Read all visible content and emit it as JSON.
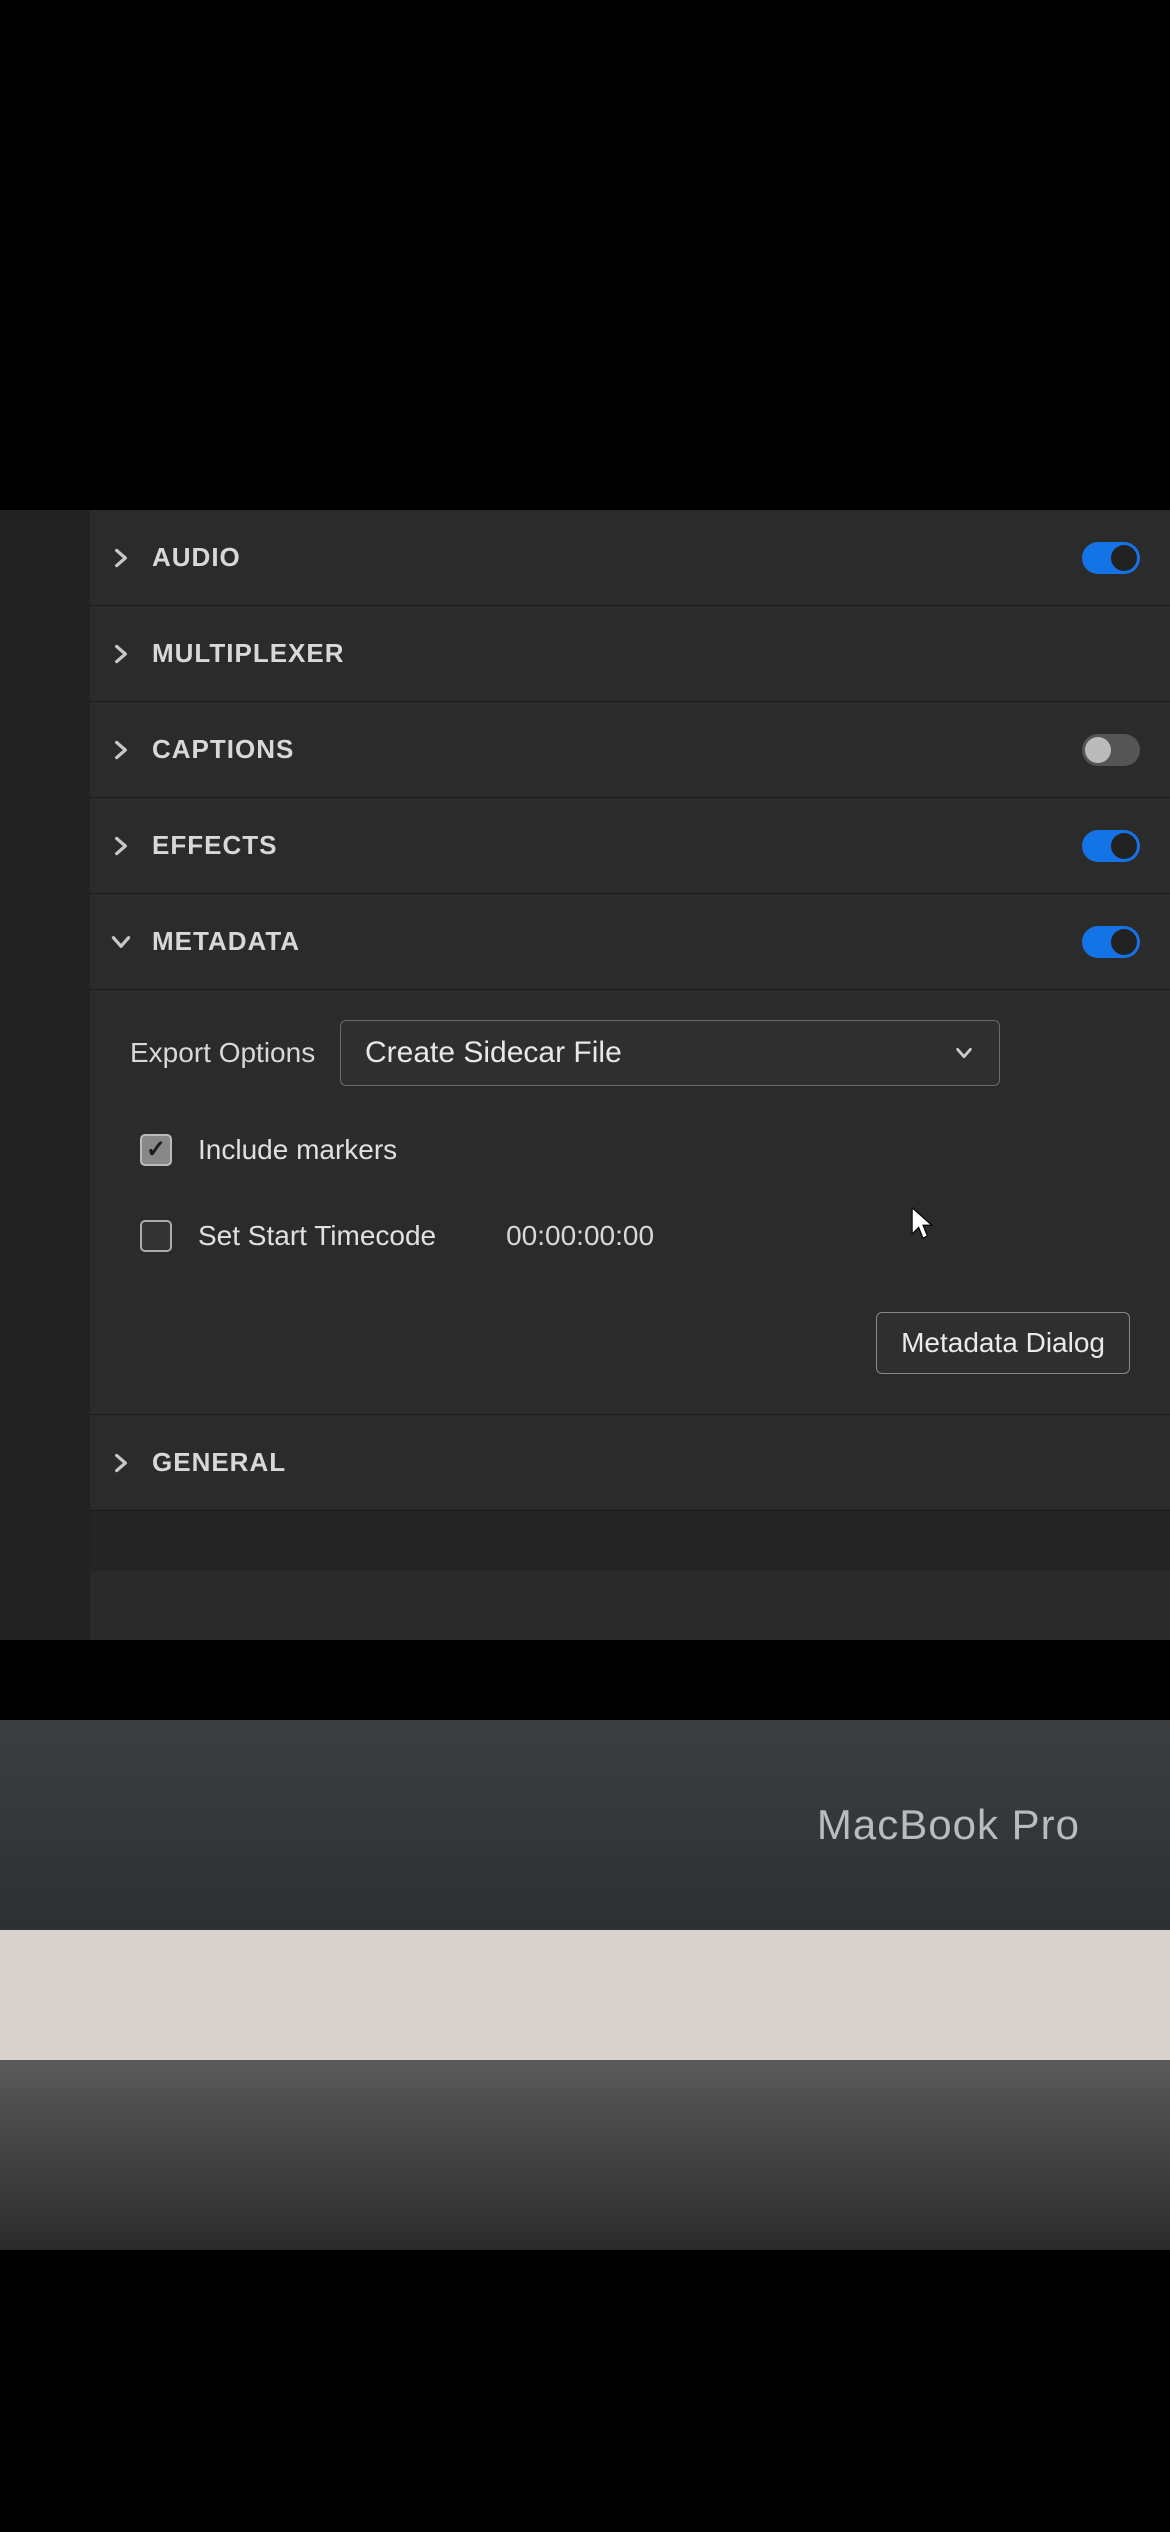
{
  "sections": {
    "audio": {
      "label": "AUDIO",
      "expanded": false,
      "toggle": true
    },
    "multiplexer": {
      "label": "MULTIPLEXER",
      "expanded": false,
      "toggle": null
    },
    "captions": {
      "label": "CAPTIONS",
      "expanded": false,
      "toggle": false
    },
    "effects": {
      "label": "EFFECTS",
      "expanded": false,
      "toggle": true
    },
    "metadata": {
      "label": "METADATA",
      "expanded": true,
      "toggle": true
    },
    "general": {
      "label": "GENERAL",
      "expanded": false,
      "toggle": null
    }
  },
  "metadata": {
    "export_options_label": "Export Options",
    "export_options_value": "Create Sidecar File",
    "include_markers_label": "Include markers",
    "include_markers_checked": true,
    "set_start_tc_label": "Set Start Timecode",
    "set_start_tc_checked": false,
    "start_tc_value": "00:00:00:00",
    "metadata_dialog_button": "Metadata Dialog"
  },
  "device_brand": "MacBook Pro"
}
